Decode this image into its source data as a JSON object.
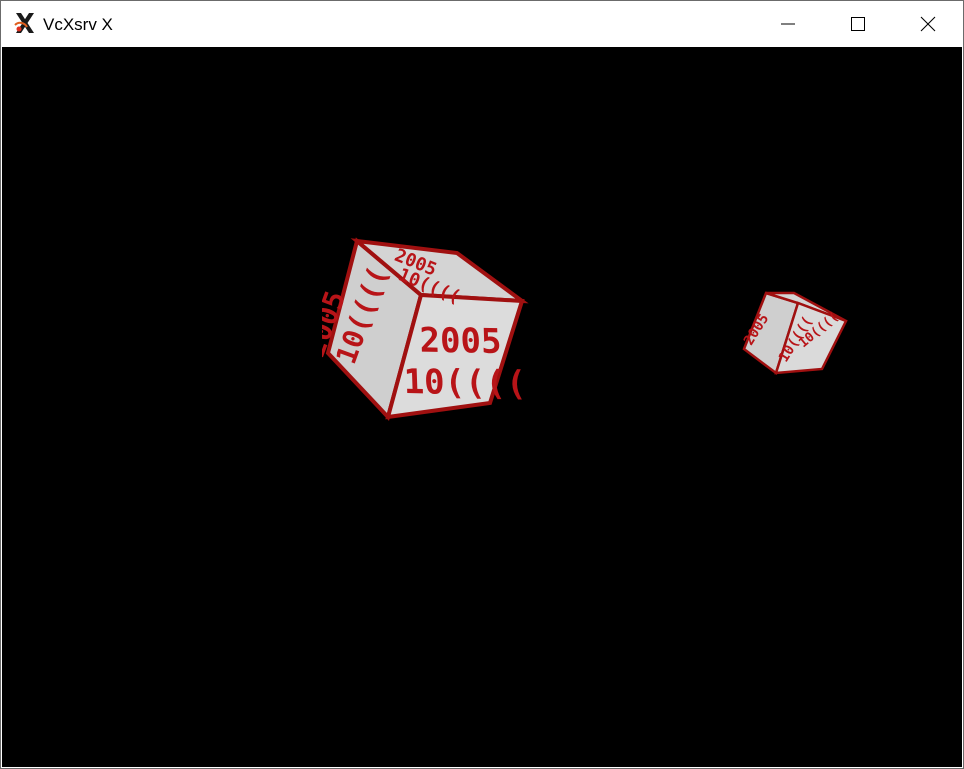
{
  "window": {
    "title": "VcXsrv X",
    "controls": {
      "minimize_icon": "minimize-icon",
      "maximize_icon": "maximize-icon",
      "close_icon": "close-icon"
    }
  },
  "scene": {
    "background": "#000000",
    "cube_texture_text": [
      "2005",
      "10(((("
    ],
    "texture_colors": {
      "face": "#d9d9d9",
      "ink": "#c0181c",
      "edge": "#8a0c0c"
    }
  }
}
